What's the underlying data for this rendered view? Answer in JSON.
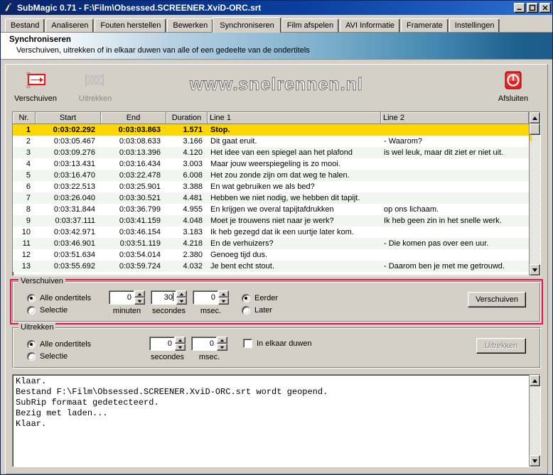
{
  "window": {
    "title": "SubMagic 0.71 - F:\\Film\\Obsessed.SCREENER.XviD-ORC.srt",
    "minimize_label": "_",
    "maximize_label": "□",
    "close_label": "✕"
  },
  "tabs": [
    {
      "label": "Bestand",
      "active": false
    },
    {
      "label": "Analiseren",
      "active": false
    },
    {
      "label": "Fouten herstellen",
      "active": false
    },
    {
      "label": "Bewerken",
      "active": false
    },
    {
      "label": "Synchroniseren",
      "active": true
    },
    {
      "label": "Film afspelen",
      "active": false
    },
    {
      "label": "AVI Informatie",
      "active": false
    },
    {
      "label": "Framerate",
      "active": false
    },
    {
      "label": "Instellingen",
      "active": false
    }
  ],
  "banner": {
    "title": "Synchroniseren",
    "subtitle": "Verschuiven, uitrekken of in elkaar duwen van alle of een gedeelte van de ondertitels"
  },
  "toolbar": {
    "site_url": "www.snelrennen.nl",
    "buttons": [
      {
        "label": "Verschuiven",
        "icon": "shift-arrow-icon",
        "enabled": true
      },
      {
        "label": "Uitrekken",
        "icon": "stretch-icon",
        "enabled": false
      }
    ],
    "exit": {
      "label": "Afsluiten",
      "icon": "power-off-icon"
    }
  },
  "grid": {
    "columns": [
      "Nr.",
      "Start",
      "End",
      "Duration",
      "Line 1",
      "Line 2"
    ],
    "rows": [
      {
        "nr": "1",
        "start": "0:03:02.292",
        "end": "0:03:03.863",
        "dur": "1.571",
        "l1": "Stop.",
        "l2": "",
        "selected": true
      },
      {
        "nr": "2",
        "start": "0:03:05.467",
        "end": "0:03:08.633",
        "dur": "3.166",
        "l1": "Dit gaat eruit.",
        "l2": "- Waarom?",
        "selected": false
      },
      {
        "nr": "3",
        "start": "0:03:09.276",
        "end": "0:03:13.396",
        "dur": "4.120",
        "l1": "Het idee van een spiegel aan het plafond",
        "l2": "is wel leuk, maar dit ziet er niet uit.",
        "selected": false
      },
      {
        "nr": "4",
        "start": "0:03:13.431",
        "end": "0:03:16.434",
        "dur": "3.003",
        "l1": "Maar jouw weerspiegeling is zo mooi.",
        "l2": "",
        "selected": false
      },
      {
        "nr": "5",
        "start": "0:03:16.470",
        "end": "0:03:22.478",
        "dur": "6.008",
        "l1": "Het zou zonde zijn om dat weg te halen.",
        "l2": "",
        "selected": false
      },
      {
        "nr": "6",
        "start": "0:03:22.513",
        "end": "0:03:25.901",
        "dur": "3.388",
        "l1": "En wat gebruiken we als bed?",
        "l2": "",
        "selected": false
      },
      {
        "nr": "7",
        "start": "0:03:26.040",
        "end": "0:03:30.521",
        "dur": "4.481",
        "l1": "Hebben we niet nodig, we hebben dit tapijt.",
        "l2": "",
        "selected": false
      },
      {
        "nr": "8",
        "start": "0:03:31.844",
        "end": "0:03:36.799",
        "dur": "4.955",
        "l1": "En krijgen we overal tapijtafdrukken",
        "l2": "op ons lichaam.",
        "selected": false
      },
      {
        "nr": "9",
        "start": "0:03:37.111",
        "end": "0:03:41.159",
        "dur": "4.048",
        "l1": "Moet je trouwens niet naar je werk?",
        "l2": "Ik heb geen zin in het snelle werk.",
        "selected": false
      },
      {
        "nr": "10",
        "start": "0:03:42.971",
        "end": "0:03:46.154",
        "dur": "3.183",
        "l1": "Ik heb gezegd dat ik een uurtje later kom.",
        "l2": "",
        "selected": false
      },
      {
        "nr": "11",
        "start": "0:03:46.901",
        "end": "0:03:51.119",
        "dur": "4.218",
        "l1": "En de verhuizers?",
        "l2": "- Die komen pas over een uur.",
        "selected": false
      },
      {
        "nr": "12",
        "start": "0:03:51.634",
        "end": "0:03:54.014",
        "dur": "2.380",
        "l1": "Genoeg tijd dus.",
        "l2": "",
        "selected": false
      },
      {
        "nr": "13",
        "start": "0:03:55.692",
        "end": "0:03:59.724",
        "dur": "4.032",
        "l1": "Je bent echt stout.",
        "l2": "- Daarom ben je met me getrouwd.",
        "selected": false
      }
    ]
  },
  "shift_group": {
    "title": "Verschuiven",
    "scope": [
      {
        "label": "Alle ondertitels",
        "selected": true
      },
      {
        "label": "Selectie",
        "selected": false
      }
    ],
    "fields": [
      {
        "caption": "minuten",
        "value": "0",
        "focused": false
      },
      {
        "caption": "secondes",
        "value": "30",
        "focused": true
      },
      {
        "caption": "msec.",
        "value": "0",
        "focused": false
      }
    ],
    "direction": [
      {
        "label": "Eerder",
        "selected": true
      },
      {
        "label": "Later",
        "selected": false
      }
    ],
    "action_label": "Verschuiven"
  },
  "stretch_group": {
    "title": "Uitrekken",
    "scope": [
      {
        "label": "Alle ondertitels",
        "selected": true
      },
      {
        "label": "Selectie",
        "selected": false
      }
    ],
    "fields": [
      {
        "caption": "secondes",
        "value": "0"
      },
      {
        "caption": "msec.",
        "value": "0"
      }
    ],
    "squeeze": {
      "label": "In elkaar duwen",
      "checked": false
    },
    "action_label": "Uitrekken",
    "action_enabled": false
  },
  "log": {
    "lines": [
      "Klaar.",
      "Bestand F:\\Film\\Obsessed.SCREENER.XviD-ORC.srt wordt geopend.",
      "SubRip formaat gedetecteerd.",
      "Bezig met laden...",
      "Klaar."
    ]
  },
  "colors": {
    "titlebar": "#0a246a",
    "selection": "#ffd700",
    "face": "#d4d0c8",
    "highlight_box": "#ee1144"
  }
}
